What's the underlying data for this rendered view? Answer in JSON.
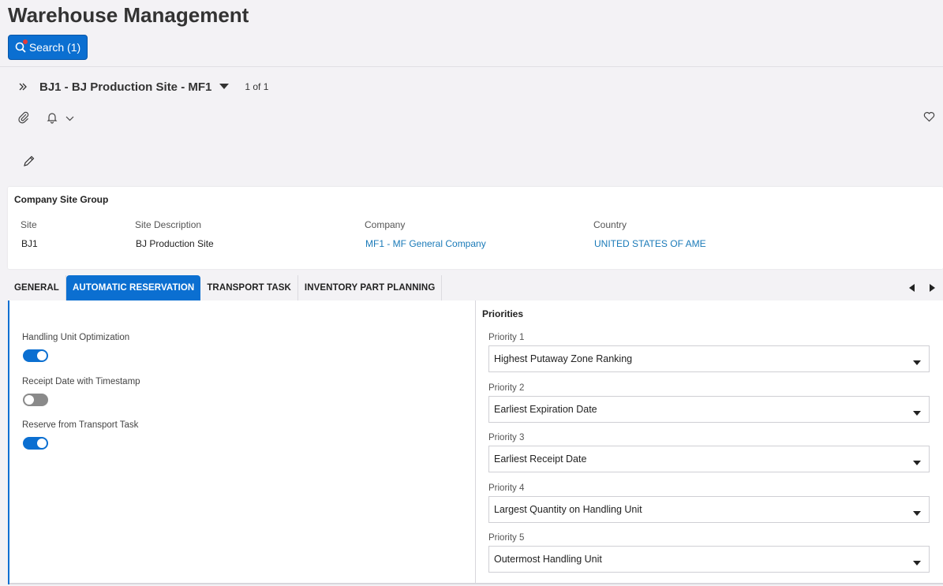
{
  "header": {
    "title": "Warehouse Management",
    "search_label": "Search (1)"
  },
  "record": {
    "title": "BJ1 - BJ Production Site - MF1",
    "count": "1 of 1"
  },
  "company_site_group": {
    "title": "Company Site Group",
    "fields": [
      {
        "label": "Site",
        "value": "BJ1"
      },
      {
        "label": "Site Description",
        "value": "BJ Production Site"
      },
      {
        "label": "Company",
        "value": "MF1 - MF General Company"
      },
      {
        "label": "Country",
        "value": "UNITED STATES OF AME"
      }
    ]
  },
  "tabs": [
    {
      "label": "GENERAL",
      "active": false
    },
    {
      "label": "AUTOMATIC RESERVATION",
      "active": true
    },
    {
      "label": "TRANSPORT TASK",
      "active": false
    },
    {
      "label": "INVENTORY PART PLANNING",
      "active": false
    }
  ],
  "toggles": [
    {
      "label": "Handling Unit Optimization",
      "on": true
    },
    {
      "label": "Receipt Date with Timestamp",
      "on": false
    },
    {
      "label": "Reserve from Transport Task",
      "on": true
    }
  ],
  "priorities": {
    "title": "Priorities",
    "items": [
      {
        "label": "Priority 1",
        "value": "Highest Putaway Zone Ranking"
      },
      {
        "label": "Priority 2",
        "value": "Earliest Expiration Date"
      },
      {
        "label": "Priority 3",
        "value": "Earliest Receipt Date"
      },
      {
        "label": "Priority 4",
        "value": "Largest Quantity on Handling Unit"
      },
      {
        "label": "Priority 5",
        "value": "Outermost Handling Unit"
      }
    ]
  },
  "colors": {
    "accent": "#0b6fd1",
    "link": "#1a7ab8",
    "toggle_off": "#8a8a8a"
  },
  "icons": [
    "search-icon",
    "expand-icon",
    "caret-down-icon",
    "paperclip-icon",
    "bell-icon",
    "chevron-down-icon",
    "heart-icon",
    "pencil-icon",
    "arrow-left-icon",
    "arrow-right-icon"
  ]
}
